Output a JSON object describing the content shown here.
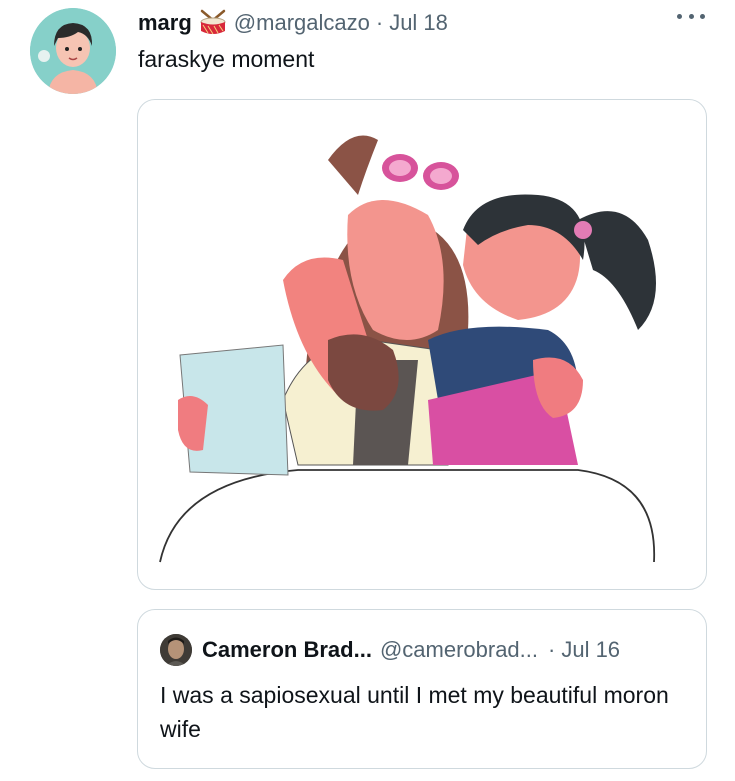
{
  "tweet": {
    "author_name": "marg",
    "author_emoji": "drum-emoji",
    "handle": "@margalcazo",
    "separator": "·",
    "date": "Jul 18",
    "text": "faraskye moment",
    "media_icon": "illustration-image"
  },
  "quoted_tweet": {
    "author_name": "Cameron Brad...",
    "handle": "@camerobrad...",
    "separator": "·",
    "date": "Jul 16",
    "text": "I was a sapiosexual until I met my beautiful moron wife"
  },
  "colors": {
    "text_primary": "#0f1419",
    "text_secondary": "#536471",
    "border": "#cfd9de",
    "avatar_bg": "#7ecbc6"
  }
}
